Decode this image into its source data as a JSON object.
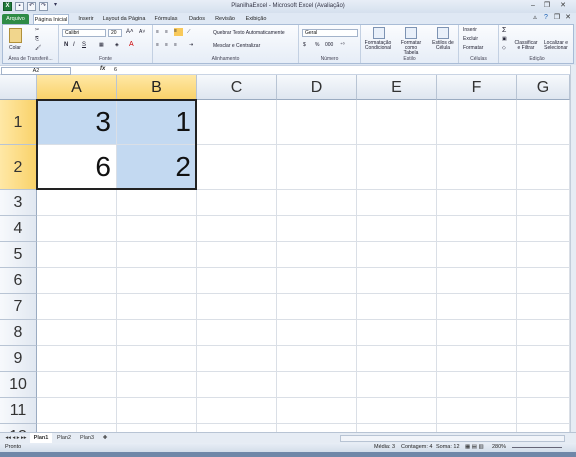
{
  "window": {
    "title": "PlanilhaExcel - Microsoft Excel (Avaliação)",
    "qat_redo": "↷",
    "qat_more": "▾"
  },
  "tabs": [
    {
      "label": "Arquivo",
      "key": "Z"
    },
    {
      "label": "Página Inicial",
      "key": "C"
    },
    {
      "label": "Inserir",
      "key": "T"
    },
    {
      "label": "Layout da Página",
      "key": "P"
    },
    {
      "label": "Fórmulas",
      "key": "U"
    },
    {
      "label": "Dados",
      "key": "S"
    },
    {
      "label": "Revisão",
      "key": "V"
    },
    {
      "label": "Exibição",
      "key": "J"
    }
  ],
  "ribbon": {
    "clipboard": {
      "label": "Área de Transferê...",
      "paste": "Colar"
    },
    "font": {
      "label": "Fonte",
      "name": "Calibri",
      "size": "20",
      "bold": "N",
      "italic": "I",
      "underline": "S"
    },
    "alignment": {
      "label": "Alinhamento",
      "wrap": "Quebrar Texto Automaticamente",
      "merge": "Mesclar e Centralizar"
    },
    "number": {
      "label": "Número",
      "format": "Geral",
      "percent": "%",
      "thousands": "000"
    },
    "styles": {
      "label": "Estilo",
      "cond": "Formatação Condicional",
      "table": "Formatar como Tabela",
      "cell": "Estilos de Célula"
    },
    "cells": {
      "label": "Células",
      "insert": "Inserir",
      "delete": "Excluir",
      "format": "Formatar"
    },
    "editing": {
      "label": "Edição",
      "sort": "Classificar e Filtrar",
      "find": "Localizar e Selecionar"
    }
  },
  "formula_bar": {
    "name_box": "A2",
    "fx": "fx",
    "value": "6"
  },
  "columns": [
    "A",
    "B",
    "C",
    "D",
    "E",
    "F",
    "G"
  ],
  "rows": [
    "1",
    "2",
    "3",
    "4",
    "5",
    "6",
    "7",
    "8",
    "9",
    "10",
    "11",
    "12"
  ],
  "cells": {
    "A1": "3",
    "B1": "1",
    "A2": "6",
    "B2": "2"
  },
  "sheets": [
    "Plan1",
    "Plan2",
    "Plan3"
  ],
  "status": {
    "mode": "Pronto",
    "average": "Média: 3",
    "count": "Contagem: 4",
    "sum": "Soma: 12",
    "zoom": "280%"
  }
}
